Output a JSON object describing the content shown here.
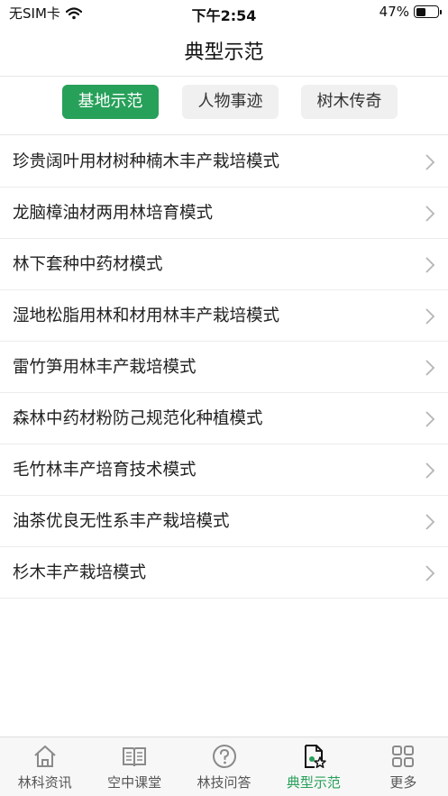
{
  "status_bar": {
    "carrier": "无SIM卡",
    "time": "下午2:54",
    "battery": "47%",
    "battery_level": 0.47
  },
  "header": {
    "title": "典型示范"
  },
  "segments": [
    {
      "label": "基地示范",
      "active": true
    },
    {
      "label": "人物事迹",
      "active": false
    },
    {
      "label": "树木传奇",
      "active": false
    }
  ],
  "list": [
    {
      "label": "珍贵阔叶用材树种楠木丰产栽培模式"
    },
    {
      "label": "龙脑樟油材两用林培育模式"
    },
    {
      "label": "林下套种中药材模式"
    },
    {
      "label": "湿地松脂用林和材用林丰产栽培模式"
    },
    {
      "label": "雷竹笋用林丰产栽培模式"
    },
    {
      "label": "森林中药材粉防己规范化种植模式"
    },
    {
      "label": "毛竹林丰产培育技术模式"
    },
    {
      "label": "油茶优良无性系丰产栽培模式"
    },
    {
      "label": "杉木丰产栽培模式"
    }
  ],
  "tabs": [
    {
      "label": "林科资讯",
      "icon": "home-icon",
      "active": false
    },
    {
      "label": "空中课堂",
      "icon": "book-icon",
      "active": false
    },
    {
      "label": "林技问答",
      "icon": "question-icon",
      "active": false
    },
    {
      "label": "典型示范",
      "icon": "document-star-icon",
      "active": true
    },
    {
      "label": "更多",
      "icon": "grid-icon",
      "active": false
    }
  ],
  "colors": {
    "accent": "#27a05a",
    "inactive_icon": "#8a8a8a"
  }
}
